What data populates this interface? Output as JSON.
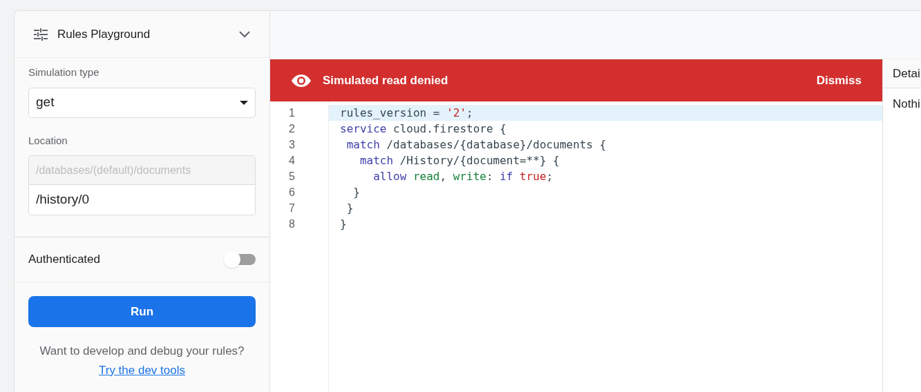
{
  "panel": {
    "title": "Rules Playground",
    "expanded": true,
    "simulation_type": {
      "label": "Simulation type",
      "value": "get"
    },
    "location": {
      "label": "Location",
      "prefix": "/databases/(default)/documents",
      "value": "/history/0"
    },
    "authenticated": {
      "label": "Authenticated",
      "on": false
    },
    "run_button": "Run",
    "hint": "Want to develop and debug your rules?",
    "link": "Try the dev tools"
  },
  "banner": {
    "message": "Simulated read denied",
    "action": "Dismiss"
  },
  "editor": {
    "lines": [
      {
        "number": "1",
        "highlighted": true,
        "tokens": [
          {
            "text": "rules_version = ",
            "kind": "plain"
          },
          {
            "text": "'2'",
            "kind": "string"
          },
          {
            "text": ";",
            "kind": "plain"
          }
        ]
      },
      {
        "number": "2",
        "highlighted": false,
        "tokens": [
          {
            "text": "service",
            "kind": "keyword"
          },
          {
            "text": " cloud.firestore {",
            "kind": "plain"
          }
        ]
      },
      {
        "number": "3",
        "highlighted": false,
        "tokens": [
          {
            "text": " match",
            "kind": "keyword"
          },
          {
            "text": " /databases/{database}/documents {",
            "kind": "plain"
          }
        ]
      },
      {
        "number": "4",
        "highlighted": false,
        "tokens": [
          {
            "text": "   match",
            "kind": "keyword"
          },
          {
            "text": " /History/{document=**} {",
            "kind": "plain"
          }
        ]
      },
      {
        "number": "5",
        "highlighted": false,
        "tokens": [
          {
            "text": "     allow",
            "kind": "keyword"
          },
          {
            "text": " read",
            "kind": "method"
          },
          {
            "text": ", ",
            "kind": "plain"
          },
          {
            "text": "write",
            "kind": "method"
          },
          {
            "text": ": ",
            "kind": "plain"
          },
          {
            "text": "if",
            "kind": "keyword"
          },
          {
            "text": " true",
            "kind": "literal"
          },
          {
            "text": ";",
            "kind": "plain"
          }
        ]
      },
      {
        "number": "6",
        "highlighted": false,
        "tokens": [
          {
            "text": "  }",
            "kind": "plain"
          }
        ]
      },
      {
        "number": "7",
        "highlighted": false,
        "tokens": [
          {
            "text": " }",
            "kind": "plain"
          }
        ]
      },
      {
        "number": "8",
        "highlighted": false,
        "tokens": [
          {
            "text": "}",
            "kind": "plain"
          }
        ]
      }
    ]
  },
  "details": {
    "heading": "Detai",
    "body": "Nothi"
  }
}
